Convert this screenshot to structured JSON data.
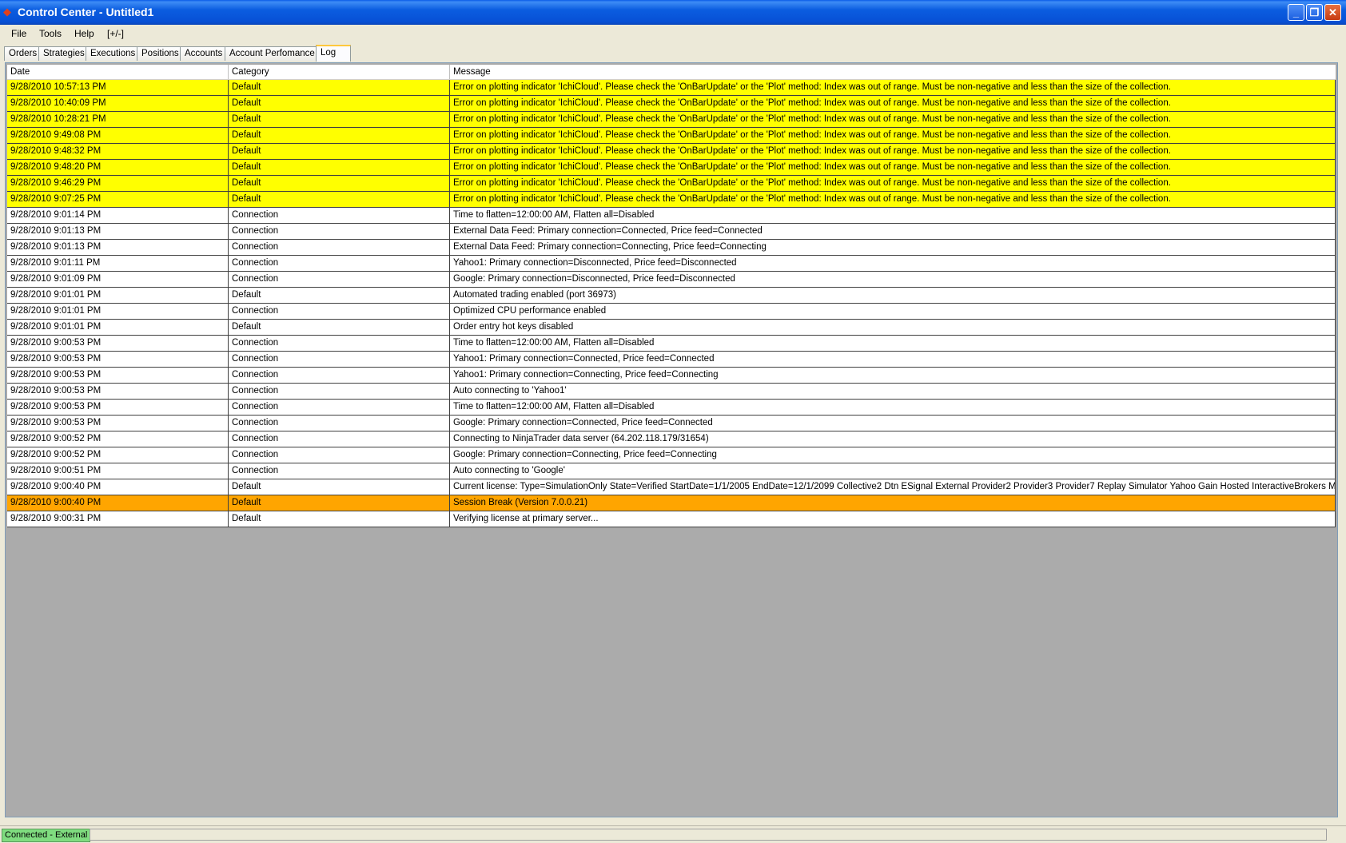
{
  "window": {
    "title": "Control Center - Untitled1",
    "controls": {
      "minimize": "_",
      "restore": "❐",
      "close": "✕"
    }
  },
  "menu": [
    {
      "label": "File"
    },
    {
      "label": "Tools"
    },
    {
      "label": "Help"
    },
    {
      "label": "[+/-]"
    }
  ],
  "tabs": [
    {
      "label": "Orders"
    },
    {
      "label": "Strategies"
    },
    {
      "label": "Executions"
    },
    {
      "label": "Positions"
    },
    {
      "label": "Accounts"
    },
    {
      "label": "Account Perfomance"
    },
    {
      "label": "Log",
      "active": true
    }
  ],
  "log": {
    "columns": [
      "Date",
      "Category",
      "Message"
    ],
    "row_colors": {
      "error": "#ffff00",
      "session": "#ffa500",
      "normal": "#ffffff"
    },
    "rows": [
      {
        "date": "9/28/2010 10:57:13 PM",
        "category": "Default",
        "message": "Error on plotting indicator 'IchiCloud'. Please check the 'OnBarUpdate' or the 'Plot' method: Index was out of range. Must be non-negative and less than the size of the collection.",
        "kind": "error"
      },
      {
        "date": "9/28/2010 10:40:09 PM",
        "category": "Default",
        "message": "Error on plotting indicator 'IchiCloud'. Please check the 'OnBarUpdate' or the 'Plot' method: Index was out of range. Must be non-negative and less than the size of the collection.",
        "kind": "error"
      },
      {
        "date": "9/28/2010 10:28:21 PM",
        "category": "Default",
        "message": "Error on plotting indicator 'IchiCloud'. Please check the 'OnBarUpdate' or the 'Plot' method: Index was out of range. Must be non-negative and less than the size of the collection.",
        "kind": "error"
      },
      {
        "date": "9/28/2010 9:49:08 PM",
        "category": "Default",
        "message": "Error on plotting indicator 'IchiCloud'. Please check the 'OnBarUpdate' or the 'Plot' method: Index was out of range. Must be non-negative and less than the size of the collection.",
        "kind": "error"
      },
      {
        "date": "9/28/2010 9:48:32 PM",
        "category": "Default",
        "message": "Error on plotting indicator 'IchiCloud'. Please check the 'OnBarUpdate' or the 'Plot' method: Index was out of range. Must be non-negative and less than the size of the collection.",
        "kind": "error"
      },
      {
        "date": "9/28/2010 9:48:20 PM",
        "category": "Default",
        "message": "Error on plotting indicator 'IchiCloud'. Please check the 'OnBarUpdate' or the 'Plot' method: Index was out of range. Must be non-negative and less than the size of the collection.",
        "kind": "error"
      },
      {
        "date": "9/28/2010 9:46:29 PM",
        "category": "Default",
        "message": "Error on plotting indicator 'IchiCloud'. Please check the 'OnBarUpdate' or the 'Plot' method: Index was out of range. Must be non-negative and less than the size of the collection.",
        "kind": "error"
      },
      {
        "date": "9/28/2010 9:07:25 PM",
        "category": "Default",
        "message": "Error on plotting indicator 'IchiCloud'. Please check the 'OnBarUpdate' or the 'Plot' method: Index was out of range. Must be non-negative and less than the size of the collection.",
        "kind": "error"
      },
      {
        "date": "9/28/2010 9:01:14 PM",
        "category": "Connection",
        "message": "Time to flatten=12:00:00 AM, Flatten all=Disabled",
        "kind": "normal"
      },
      {
        "date": "9/28/2010 9:01:13 PM",
        "category": "Connection",
        "message": "External Data Feed: Primary connection=Connected, Price feed=Connected",
        "kind": "normal"
      },
      {
        "date": "9/28/2010 9:01:13 PM",
        "category": "Connection",
        "message": "External Data Feed: Primary connection=Connecting, Price feed=Connecting",
        "kind": "normal"
      },
      {
        "date": "9/28/2010 9:01:11 PM",
        "category": "Connection",
        "message": "Yahoo1: Primary connection=Disconnected, Price feed=Disconnected",
        "kind": "normal"
      },
      {
        "date": "9/28/2010 9:01:09 PM",
        "category": "Connection",
        "message": "Google: Primary connection=Disconnected, Price feed=Disconnected",
        "kind": "normal"
      },
      {
        "date": "9/28/2010 9:01:01 PM",
        "category": "Default",
        "message": "Automated trading enabled (port 36973)",
        "kind": "normal"
      },
      {
        "date": "9/28/2010 9:01:01 PM",
        "category": "Connection",
        "message": "Optimized CPU performance enabled",
        "kind": "normal"
      },
      {
        "date": "9/28/2010 9:01:01 PM",
        "category": "Default",
        "message": "Order entry hot keys disabled",
        "kind": "normal"
      },
      {
        "date": "9/28/2010 9:00:53 PM",
        "category": "Connection",
        "message": "Time to flatten=12:00:00 AM, Flatten all=Disabled",
        "kind": "normal"
      },
      {
        "date": "9/28/2010 9:00:53 PM",
        "category": "Connection",
        "message": "Yahoo1: Primary connection=Connected, Price feed=Connected",
        "kind": "normal"
      },
      {
        "date": "9/28/2010 9:00:53 PM",
        "category": "Connection",
        "message": "Yahoo1: Primary connection=Connecting, Price feed=Connecting",
        "kind": "normal"
      },
      {
        "date": "9/28/2010 9:00:53 PM",
        "category": "Connection",
        "message": "Auto connecting to 'Yahoo1'",
        "kind": "normal"
      },
      {
        "date": "9/28/2010 9:00:53 PM",
        "category": "Connection",
        "message": "Time to flatten=12:00:00 AM, Flatten all=Disabled",
        "kind": "normal"
      },
      {
        "date": "9/28/2010 9:00:53 PM",
        "category": "Connection",
        "message": "Google: Primary connection=Connected, Price feed=Connected",
        "kind": "normal"
      },
      {
        "date": "9/28/2010 9:00:52 PM",
        "category": "Connection",
        "message": "Connecting to NinjaTrader data server (64.202.118.179/31654)",
        "kind": "normal"
      },
      {
        "date": "9/28/2010 9:00:52 PM",
        "category": "Connection",
        "message": "Google: Primary connection=Connecting, Price feed=Connecting",
        "kind": "normal"
      },
      {
        "date": "9/28/2010 9:00:51 PM",
        "category": "Connection",
        "message": "Auto connecting to 'Google'",
        "kind": "normal"
      },
      {
        "date": "9/28/2010 9:00:40 PM",
        "category": "Default",
        "message": "Current license: Type=SimulationOnly State=Verified StartDate=1/1/2005 EndDate=12/1/2099 Collective2 Dtn ESignal External Provider2 Provider3 Provider7 Replay Simulator Yahoo Gain Hosted InteractiveBrokers MB",
        "kind": "normal"
      },
      {
        "date": "9/28/2010 9:00:40 PM",
        "category": "Default",
        "message": "Session Break (Version 7.0.0.21)",
        "kind": "session"
      },
      {
        "date": "9/28/2010 9:00:31 PM",
        "category": "Default",
        "message": "Verifying license at primary server...",
        "kind": "normal"
      }
    ]
  },
  "status": {
    "connection": "Connected - External",
    "connection_color": "#7fdc7f"
  }
}
